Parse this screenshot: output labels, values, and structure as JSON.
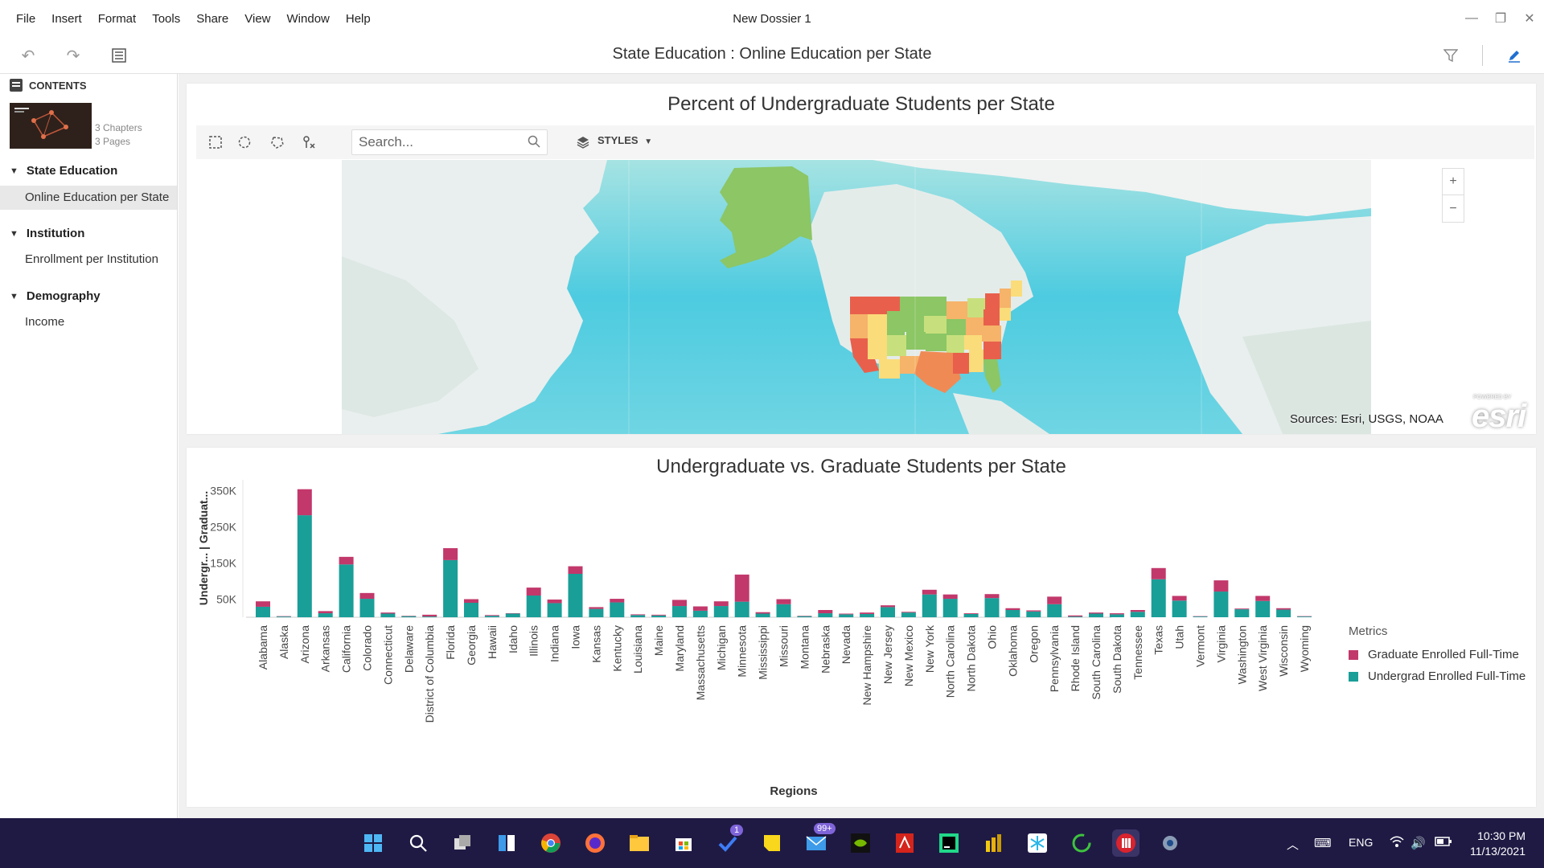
{
  "window": {
    "title": "New Dossier 1",
    "menu": [
      "File",
      "Insert",
      "Format",
      "Tools",
      "Share",
      "View",
      "Window",
      "Help"
    ]
  },
  "toolbar": {
    "page_title": "State Education : Online Education per State",
    "icons": [
      "undo-icon",
      "redo-icon",
      "table-of-contents-icon",
      "filter-icon",
      "edit-pen-icon"
    ]
  },
  "sidebar": {
    "header": "CONTENTS",
    "summary": {
      "chapters": "3 Chapters",
      "pages": "3 Pages"
    },
    "chapters": [
      {
        "title": "State Education",
        "pages": [
          "Online Education per State"
        ]
      },
      {
        "title": "Institution",
        "pages": [
          "Enrollment per Institution"
        ]
      },
      {
        "title": "Demography",
        "pages": [
          "Income"
        ]
      }
    ]
  },
  "map_card": {
    "title": "Percent of Undergraduate Students per State",
    "search_placeholder": "Search...",
    "styles_label": "STYLES",
    "zoom_in": "+",
    "zoom_out": "−",
    "sources": "Sources: Esri, USGS, NOAA",
    "esri_logo": "esri",
    "esri_powered": "POWERED BY"
  },
  "chart_card": {
    "title": "Undergraduate vs. Graduate Students per State",
    "ylabel": "Undergr...  |  Graduat...",
    "xlabel": "Regions",
    "legend_title": "Metrics",
    "colors": {
      "graduate": "#c2386b",
      "undergrad": "#1a9e98"
    }
  },
  "chart_data": {
    "type": "bar",
    "stacked": true,
    "title": "Undergraduate vs. Graduate Students per State",
    "xlabel": "Regions",
    "ylabel": "Undergr...  |  Graduat...",
    "ylim": [
      0,
      350000
    ],
    "yticks": [
      50000,
      150000,
      250000,
      350000
    ],
    "ytick_labels": [
      "50K",
      "150K",
      "250K",
      "350K"
    ],
    "legend_position": "right",
    "categories": [
      "Alabama",
      "Alaska",
      "Arizona",
      "Arkansas",
      "California",
      "Colorado",
      "Connecticut",
      "Delaware",
      "District of Columbia",
      "Florida",
      "Georgia",
      "Hawaii",
      "Idaho",
      "Illinois",
      "Indiana",
      "Iowa",
      "Kansas",
      "Kentucky",
      "Louisiana",
      "Maine",
      "Maryland",
      "Massachusetts",
      "Michigan",
      "Minnesota",
      "Mississippi",
      "Missouri",
      "Montana",
      "Nebraska",
      "Nevada",
      "New Hampshire",
      "New Jersey",
      "New Mexico",
      "New York",
      "North Carolina",
      "North Dakota",
      "Ohio",
      "Oklahoma",
      "Oregon",
      "Pennsylvania",
      "Rhode Island",
      "South Carolina",
      "South Dakota",
      "Tennessee",
      "Texas",
      "Utah",
      "Vermont",
      "Virginia",
      "Washington",
      "West Virginia",
      "Wisconsin",
      "Wyoming"
    ],
    "series": [
      {
        "name": "Undergrad Enrolled Full-Time",
        "color": "#1a9e98",
        "values": [
          29000,
          2000,
          282000,
          11000,
          146000,
          51000,
          10000,
          3000,
          2000,
          158000,
          40000,
          4000,
          10000,
          60000,
          39000,
          120000,
          23000,
          41000,
          6000,
          5000,
          31000,
          18000,
          31000,
          43000,
          10000,
          36000,
          3000,
          11000,
          8000,
          9000,
          28000,
          13000,
          63000,
          51000,
          9000,
          53000,
          20000,
          16000,
          36000,
          2000,
          10000,
          8000,
          15000,
          105000,
          46000,
          2000,
          71000,
          22000,
          45000,
          21000,
          2000
        ]
      },
      {
        "name": "Graduate Enrolled Full-Time",
        "color": "#c2386b",
        "values": [
          15000,
          1000,
          72000,
          6000,
          21000,
          16000,
          3000,
          1000,
          5000,
          33000,
          10000,
          2000,
          1000,
          22000,
          10000,
          21000,
          5000,
          10000,
          2000,
          2000,
          17000,
          12000,
          13000,
          75000,
          4000,
          14000,
          1000,
          9000,
          2000,
          4000,
          5000,
          2000,
          13000,
          12000,
          2000,
          11000,
          5000,
          3000,
          21000,
          3000,
          3000,
          3000,
          5000,
          31000,
          13000,
          1000,
          31000,
          2000,
          14000,
          4000,
          1000
        ]
      }
    ]
  },
  "taskbar": {
    "lang": "ENG",
    "time": "10:30 PM",
    "date": "11/13/2021",
    "badge_mail": "99+",
    "badge_todo": "1"
  }
}
